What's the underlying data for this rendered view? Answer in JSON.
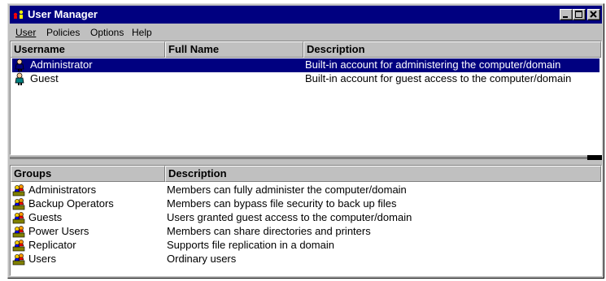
{
  "window": {
    "title": "User Manager"
  },
  "menu": [
    "User",
    "Policies",
    "Options",
    "Help"
  ],
  "users": {
    "columns": [
      "Username",
      "Full Name",
      "Description"
    ],
    "rows": [
      {
        "username": "Administrator",
        "full_name": "",
        "description": "Built-in account for administering the computer/domain",
        "selected": true
      },
      {
        "username": "Guest",
        "full_name": "",
        "description": "Built-in account for guest access to the computer/domain",
        "selected": false
      }
    ]
  },
  "groups": {
    "columns": [
      "Groups",
      "Description"
    ],
    "rows": [
      {
        "name": "Administrators",
        "description": "Members can fully administer the computer/domain"
      },
      {
        "name": "Backup Operators",
        "description": "Members can bypass file security to back up files"
      },
      {
        "name": "Guests",
        "description": "Users granted guest access to the computer/domain"
      },
      {
        "name": "Power Users",
        "description": "Members can share directories and printers"
      },
      {
        "name": "Replicator",
        "description": "Supports file replication in a domain"
      },
      {
        "name": "Users",
        "description": "Ordinary users"
      }
    ]
  },
  "colors": {
    "title_bar": "#000080",
    "selection": "#000080",
    "face": "#c0c0c0"
  },
  "icons": {
    "title": "user-manager-icon",
    "user": "user-icon",
    "group": "group-icon"
  }
}
